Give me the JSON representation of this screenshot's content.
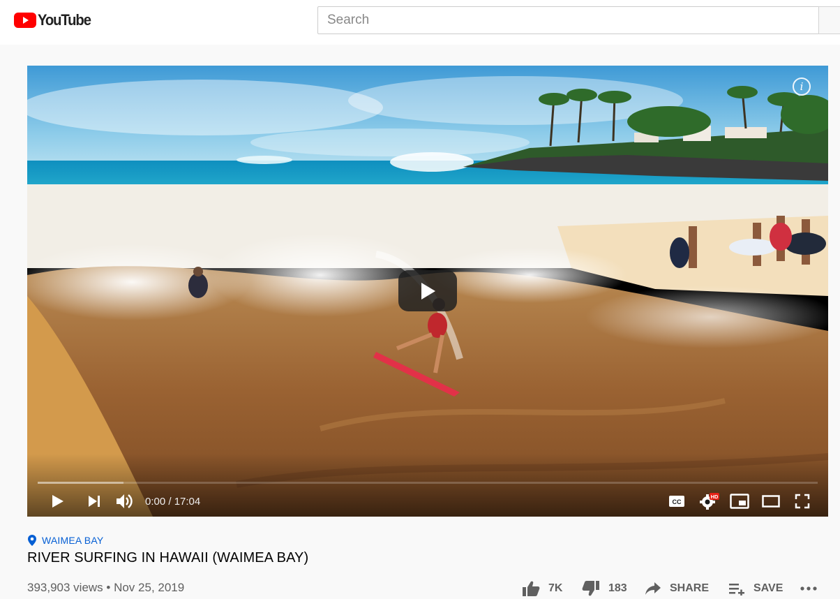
{
  "header": {
    "brand": "YouTube",
    "search_placeholder": "Search"
  },
  "player": {
    "current_time": "0:00",
    "duration": "17:04",
    "time_display": "0:00 / 17:04",
    "quality_badge": "HD",
    "loaded_fraction": 0.11,
    "played_fraction": 0.0
  },
  "video": {
    "location": "WAIMEA BAY",
    "title": "RIVER SURFING IN HAWAII (WAIMEA BAY)",
    "views_date": "393,903 views • Nov 25, 2019"
  },
  "actions": {
    "likes": "7K",
    "dislikes": "183",
    "share_label": "SHARE",
    "save_label": "SAVE"
  },
  "colors": {
    "brand_red": "#ff0000",
    "link_blue": "#065fd4",
    "meta_gray": "#606060"
  },
  "icons": [
    "youtube-logo-icon",
    "info-icon",
    "play-icon",
    "next-icon",
    "volume-icon",
    "captions-icon",
    "settings-icon",
    "miniplayer-icon",
    "theater-icon",
    "fullscreen-icon",
    "location-pin-icon",
    "thumbs-up-icon",
    "thumbs-down-icon",
    "share-icon",
    "save-playlist-icon",
    "more-icon"
  ]
}
